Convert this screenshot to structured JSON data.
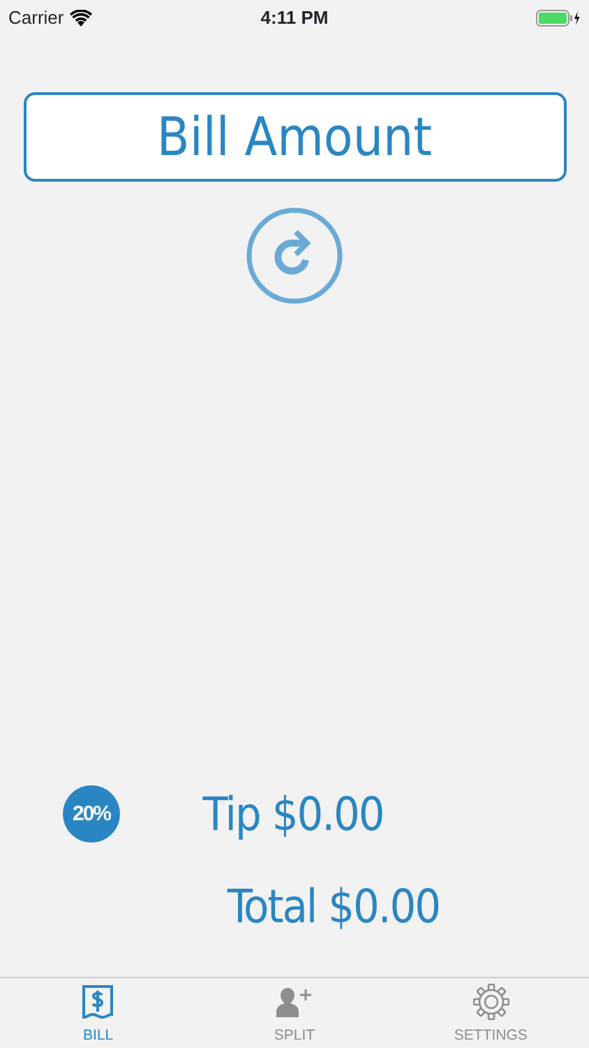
{
  "status_bar": {
    "carrier": "Carrier",
    "time": "4:11 PM"
  },
  "bill": {
    "placeholder": "Bill Amount"
  },
  "tip_percent": "20%",
  "tip": "Tip $0.00",
  "total": "Total $0.00",
  "tabs": [
    {
      "label": "BILL",
      "kind": "bill",
      "selected": true
    },
    {
      "label": "SPLIT",
      "kind": "split",
      "selected": false
    },
    {
      "label": "SETTINGS",
      "kind": "settings",
      "selected": false
    }
  ]
}
